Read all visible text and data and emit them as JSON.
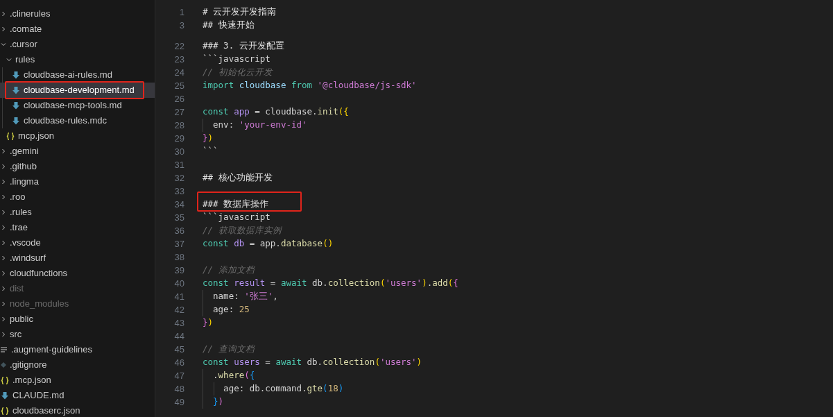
{
  "explorer": {
    "items": [
      {
        "name": ".clinerules",
        "kind": "folder",
        "expanded": false,
        "dimmed": false
      },
      {
        "name": ".comate",
        "kind": "folder",
        "expanded": false,
        "dimmed": false
      },
      {
        "name": ".cursor",
        "kind": "folder",
        "expanded": true,
        "dimmed": false,
        "children": [
          {
            "name": "rules",
            "kind": "folder",
            "expanded": true,
            "dimmed": false,
            "children": [
              {
                "name": "cloudbase-ai-rules.md",
                "kind": "md",
                "selected": false,
                "annotated": false,
                "dimmed": false
              },
              {
                "name": "cloudbase-development.md",
                "kind": "md",
                "selected": true,
                "annotated": true,
                "dimmed": false
              },
              {
                "name": "cloudbase-mcp-tools.md",
                "kind": "md",
                "selected": false,
                "annotated": false,
                "dimmed": false
              },
              {
                "name": "cloudbase-rules.mdc",
                "kind": "md",
                "selected": false,
                "annotated": false,
                "dimmed": false
              }
            ]
          },
          {
            "name": "mcp.json",
            "kind": "json",
            "dimmed": false
          }
        ]
      },
      {
        "name": ".gemini",
        "kind": "folder",
        "expanded": false,
        "dimmed": false
      },
      {
        "name": ".github",
        "kind": "folder",
        "expanded": false,
        "dimmed": false
      },
      {
        "name": ".lingma",
        "kind": "folder",
        "expanded": false,
        "dimmed": false
      },
      {
        "name": ".roo",
        "kind": "folder",
        "expanded": false,
        "dimmed": false
      },
      {
        "name": ".rules",
        "kind": "folder",
        "expanded": false,
        "dimmed": false
      },
      {
        "name": ".trae",
        "kind": "folder",
        "expanded": false,
        "dimmed": false
      },
      {
        "name": ".vscode",
        "kind": "folder",
        "expanded": false,
        "dimmed": false
      },
      {
        "name": ".windsurf",
        "kind": "folder",
        "expanded": false,
        "dimmed": false
      },
      {
        "name": "cloudfunctions",
        "kind": "folder",
        "expanded": false,
        "dimmed": false
      },
      {
        "name": "dist",
        "kind": "folder",
        "expanded": false,
        "dimmed": true
      },
      {
        "name": "node_modules",
        "kind": "folder",
        "expanded": false,
        "dimmed": true
      },
      {
        "name": "public",
        "kind": "folder",
        "expanded": false,
        "dimmed": false
      },
      {
        "name": "src",
        "kind": "folder",
        "expanded": false,
        "dimmed": false
      },
      {
        "name": ".augment-guidelines",
        "kind": "text",
        "dimmed": false
      },
      {
        "name": ".gitignore",
        "kind": "git",
        "dimmed": false
      },
      {
        "name": ".mcp.json",
        "kind": "json",
        "dimmed": false
      },
      {
        "name": "CLAUDE.md",
        "kind": "md",
        "dimmed": false
      },
      {
        "name": "cloudbaserc.json",
        "kind": "json",
        "dimmed": false
      }
    ]
  },
  "editor": {
    "sticky_lines": [
      {
        "number": "1",
        "tokens": [
          {
            "kind": "heading",
            "text": "# 云开发开发指南"
          }
        ]
      },
      {
        "number": "3",
        "tokens": [
          {
            "kind": "heading",
            "text": "## 快速开始"
          }
        ]
      }
    ],
    "lines": [
      {
        "number": "22",
        "tokens": [
          {
            "kind": "heading",
            "text": "### 3. 云开发配置"
          }
        ]
      },
      {
        "number": "23",
        "tokens": [
          {
            "kind": "plain",
            "text": "```javascript"
          }
        ]
      },
      {
        "number": "24",
        "tokens": [
          {
            "kind": "comment",
            "text": "// 初始化云开发"
          }
        ]
      },
      {
        "number": "25",
        "tokens": [
          {
            "kind": "keyword",
            "text": "import "
          },
          {
            "kind": "module",
            "text": "cloudbase "
          },
          {
            "kind": "keyword",
            "text": "from "
          },
          {
            "kind": "string",
            "text": "'@cloudbase/js-sdk'"
          }
        ]
      },
      {
        "number": "26"
      },
      {
        "number": "27",
        "tokens": [
          {
            "kind": "keyword",
            "text": "const "
          },
          {
            "kind": "variable",
            "text": "app"
          },
          {
            "kind": "plain",
            "text": " = cloudbase."
          },
          {
            "kind": "function",
            "text": "init"
          },
          {
            "kind": "bracket1",
            "text": "({"
          }
        ]
      },
      {
        "number": "28",
        "tokens": [
          {
            "kind": "plain",
            "text": "  env: "
          },
          {
            "kind": "string",
            "text": "'your-env-id'"
          }
        ]
      },
      {
        "number": "29",
        "tokens": [
          {
            "kind": "bracket2",
            "text": "}"
          },
          {
            "kind": "bracket1",
            "text": ")"
          }
        ]
      },
      {
        "number": "30",
        "tokens": [
          {
            "kind": "plain",
            "text": "```"
          }
        ]
      },
      {
        "number": "31"
      },
      {
        "number": "32",
        "tokens": [
          {
            "kind": "heading",
            "text": "## 核心功能开发"
          }
        ]
      },
      {
        "number": "33"
      },
      {
        "number": "34",
        "annotated": true,
        "tokens": [
          {
            "kind": "heading",
            "text": "### 数据库操作"
          }
        ]
      },
      {
        "number": "35",
        "tokens": [
          {
            "kind": "plain",
            "text": "```javascript"
          }
        ]
      },
      {
        "number": "36",
        "tokens": [
          {
            "kind": "comment",
            "text": "// 获取数据库实例"
          }
        ]
      },
      {
        "number": "37",
        "tokens": [
          {
            "kind": "keyword",
            "text": "const "
          },
          {
            "kind": "variable",
            "text": "db"
          },
          {
            "kind": "plain",
            "text": " = app."
          },
          {
            "kind": "function",
            "text": "database"
          },
          {
            "kind": "bracket1",
            "text": "()"
          }
        ]
      },
      {
        "number": "38"
      },
      {
        "number": "39",
        "tokens": [
          {
            "kind": "comment",
            "text": "// 添加文档"
          }
        ]
      },
      {
        "number": "40",
        "tokens": [
          {
            "kind": "keyword",
            "text": "const "
          },
          {
            "kind": "variable",
            "text": "result"
          },
          {
            "kind": "plain",
            "text": " = "
          },
          {
            "kind": "keyword",
            "text": "await"
          },
          {
            "kind": "plain",
            "text": " db."
          },
          {
            "kind": "function",
            "text": "collection"
          },
          {
            "kind": "bracket1",
            "text": "("
          },
          {
            "kind": "string",
            "text": "'users'"
          },
          {
            "kind": "bracket1",
            "text": ")"
          },
          {
            "kind": "plain",
            "text": "."
          },
          {
            "kind": "function",
            "text": "add"
          },
          {
            "kind": "bracket1",
            "text": "("
          },
          {
            "kind": "bracket2",
            "text": "{"
          }
        ]
      },
      {
        "number": "41",
        "tokens": [
          {
            "kind": "plain",
            "text": "  name: "
          },
          {
            "kind": "string",
            "text": "'张三'"
          },
          {
            "kind": "plain",
            "text": ","
          }
        ]
      },
      {
        "number": "42",
        "tokens": [
          {
            "kind": "plain",
            "text": "  age: "
          },
          {
            "kind": "number",
            "text": "25"
          }
        ]
      },
      {
        "number": "43",
        "tokens": [
          {
            "kind": "bracket2",
            "text": "}"
          },
          {
            "kind": "bracket1",
            "text": ")"
          }
        ]
      },
      {
        "number": "44"
      },
      {
        "number": "45",
        "tokens": [
          {
            "kind": "comment",
            "text": "// 查询文档"
          }
        ]
      },
      {
        "number": "46",
        "tokens": [
          {
            "kind": "keyword",
            "text": "const "
          },
          {
            "kind": "variable",
            "text": "users"
          },
          {
            "kind": "plain",
            "text": " = "
          },
          {
            "kind": "keyword",
            "text": "await"
          },
          {
            "kind": "plain",
            "text": " db."
          },
          {
            "kind": "function",
            "text": "collection"
          },
          {
            "kind": "bracket1",
            "text": "("
          },
          {
            "kind": "string",
            "text": "'users'"
          },
          {
            "kind": "bracket1",
            "text": ")"
          }
        ]
      },
      {
        "number": "47",
        "tokens": [
          {
            "kind": "plain",
            "text": "  ."
          },
          {
            "kind": "function",
            "text": "where"
          },
          {
            "kind": "bracket2",
            "text": "("
          },
          {
            "kind": "bracket3",
            "text": "{"
          }
        ]
      },
      {
        "number": "48",
        "tokens": [
          {
            "kind": "plain",
            "text": "    age: db.command."
          },
          {
            "kind": "function",
            "text": "gte"
          },
          {
            "kind": "bracket3",
            "text": "("
          },
          {
            "kind": "number",
            "text": "18"
          },
          {
            "kind": "bracket3",
            "text": ")"
          }
        ]
      },
      {
        "number": "49",
        "tokens": [
          {
            "kind": "bracket3",
            "text": "  }"
          },
          {
            "kind": "bracket2",
            "text": ")"
          }
        ]
      }
    ]
  }
}
